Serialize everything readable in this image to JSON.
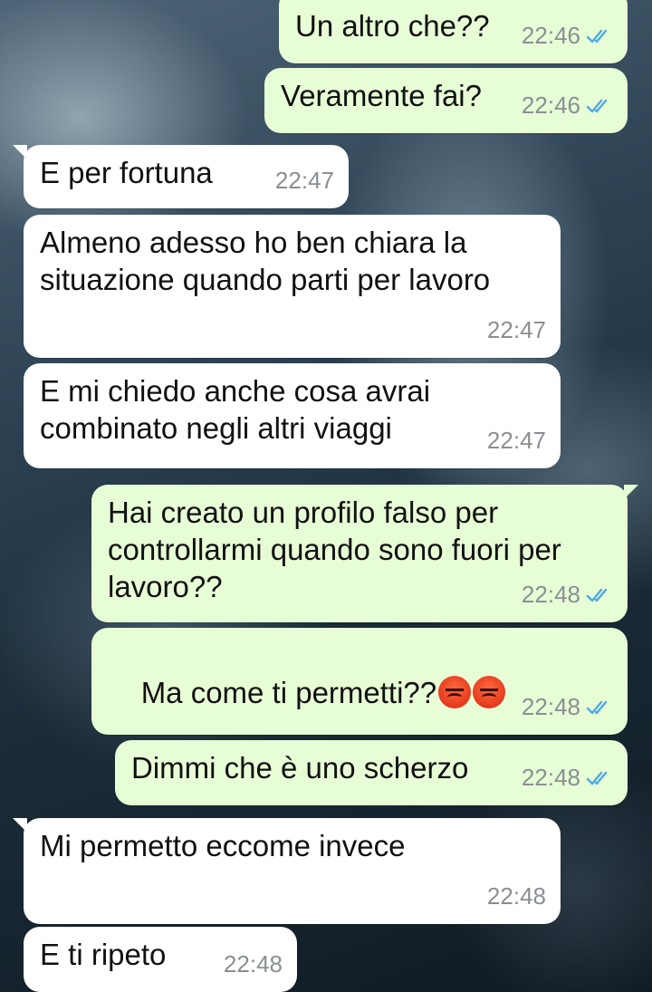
{
  "chat": {
    "messages": [
      {
        "dir": "out",
        "text": "Un altro che??",
        "time": "22:46",
        "read": true
      },
      {
        "dir": "out",
        "text": "Veramente fai?",
        "time": "22:46",
        "read": true
      },
      {
        "dir": "in",
        "text": "E per fortuna",
        "time": "22:47"
      },
      {
        "dir": "in",
        "text": "Almeno adesso ho ben chiara la situazione quando parti per lavoro",
        "time": "22:47"
      },
      {
        "dir": "in",
        "text": "E mi chiedo anche cosa avrai combinato negli altri viaggi",
        "time": "22:47"
      },
      {
        "dir": "out",
        "text": "Hai creato un profilo falso per controllarmi quando sono fuori per lavoro??",
        "time": "22:48",
        "read": true
      },
      {
        "dir": "out",
        "text": "Ma come ti permetti??",
        "time": "22:48",
        "read": true,
        "emojis": [
          "pouting-face-emoji",
          "pouting-face-emoji"
        ]
      },
      {
        "dir": "out",
        "text": "Dimmi che è uno scherzo",
        "time": "22:48",
        "read": true
      },
      {
        "dir": "in",
        "text": "Mi permetto eccome invece",
        "time": "22:48"
      },
      {
        "dir": "in",
        "text": "E ti ripeto",
        "time": "22:48"
      }
    ]
  },
  "colors": {
    "outgoing": "#e7fdd6",
    "incoming": "#ffffff",
    "read_check": "#4fa9e9"
  }
}
